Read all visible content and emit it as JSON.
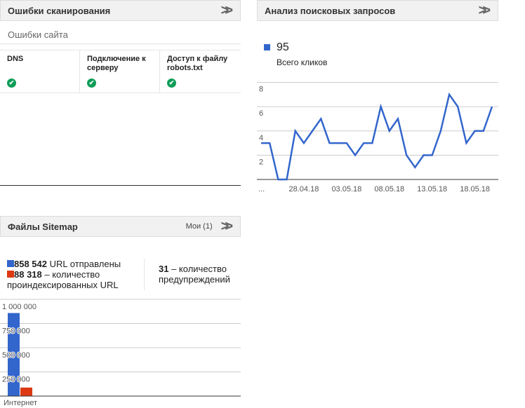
{
  "crawl": {
    "title": "Ошибки сканирования",
    "subtitle": "Ошибки сайта",
    "cells": [
      {
        "label": "DNS"
      },
      {
        "label": "Подключение к серверу"
      },
      {
        "label": "Доступ к файлу robots.txt"
      }
    ]
  },
  "search": {
    "title": "Анализ поисковых запросов",
    "total": "95",
    "total_label": "Всего кликов"
  },
  "sitemap": {
    "title": "Файлы Sitemap",
    "mine": "Мои (1)",
    "submitted_num": "858 542",
    "submitted_text": " URL отправлены",
    "indexed_num": "88 318",
    "indexed_text": " – количество проиндексированных URL",
    "warn_num": "31",
    "warn_text": " – количество предупреждений"
  },
  "colors": {
    "blue": "#3366cc",
    "red": "#dc3912",
    "green": "#0f9d58"
  },
  "chart_data": [
    {
      "type": "line",
      "title": "Всего кликов",
      "ylim": [
        0,
        8
      ],
      "yticks": [
        "2",
        "4",
        "6",
        "8"
      ],
      "x_labels": [
        {
          "i": 0,
          "t": "..."
        },
        {
          "i": 5,
          "t": "28.04.18"
        },
        {
          "i": 10,
          "t": "03.05.18"
        },
        {
          "i": 15,
          "t": "08.05.18"
        },
        {
          "i": 20,
          "t": "13.05.18"
        },
        {
          "i": 25,
          "t": "18.05.18"
        }
      ],
      "values": [
        3,
        3,
        0,
        0,
        4,
        3,
        4,
        5,
        3,
        3,
        3,
        2,
        3,
        3,
        6,
        4,
        5,
        2,
        1,
        2,
        2,
        4,
        7,
        6,
        3,
        4,
        4,
        6
      ]
    },
    {
      "type": "bar",
      "categories": [
        "Интернет"
      ],
      "ylim": [
        0,
        1000000
      ],
      "yticks": [
        "250 000",
        "500 000",
        "750 000",
        "1 000 000"
      ],
      "series": [
        {
          "name": "URL отправлены",
          "values": [
            858542
          ]
        },
        {
          "name": "проиндексированных URL",
          "values": [
            88318
          ]
        }
      ]
    }
  ]
}
